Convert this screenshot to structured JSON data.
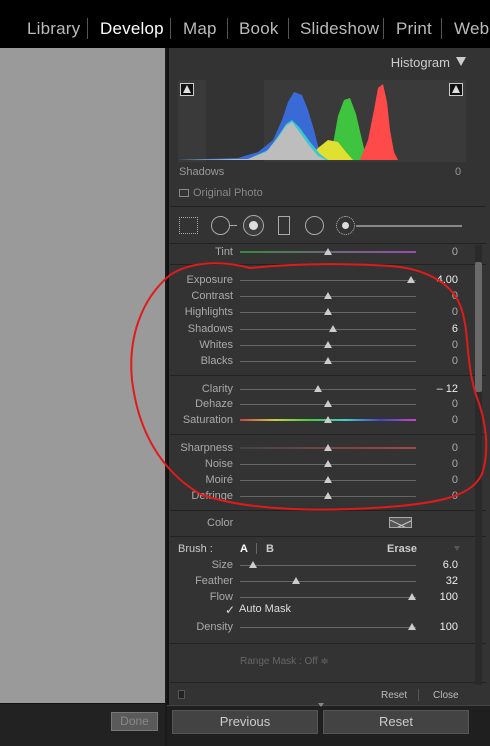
{
  "modules": [
    "Library",
    "Develop",
    "Map",
    "Book",
    "Slideshow",
    "Print",
    "Web"
  ],
  "active_module": "Develop",
  "left": {
    "done_label": "Done"
  },
  "histogram": {
    "title": "Histogram",
    "info_label": "Shadows",
    "info_value": "0",
    "original_photo_label": "Original Photo"
  },
  "tools": {
    "grid": "crop-overlay-icon",
    "spot": "spot-removal-icon",
    "redeye": "red-eye-icon",
    "grad": "graduated-filter-icon",
    "radial": "radial-filter-icon",
    "brush": "adjustment-brush-icon"
  },
  "sliders": {
    "tint": {
      "label": "Tint",
      "value": "0"
    },
    "exposure": {
      "label": "Exposure",
      "value": "4.00"
    },
    "contrast": {
      "label": "Contrast",
      "value": "0"
    },
    "highlights": {
      "label": "Highlights",
      "value": "0"
    },
    "shadows": {
      "label": "Shadows",
      "value": "6"
    },
    "whites": {
      "label": "Whites",
      "value": "0"
    },
    "blacks": {
      "label": "Blacks",
      "value": "0"
    },
    "clarity": {
      "label": "Clarity",
      "value": "– 12"
    },
    "dehaze": {
      "label": "Dehaze",
      "value": "0"
    },
    "saturation": {
      "label": "Saturation",
      "value": "0"
    },
    "sharpness": {
      "label": "Sharpness",
      "value": "0"
    },
    "noise": {
      "label": "Noise",
      "value": "0"
    },
    "moire": {
      "label": "Moiré",
      "value": "0"
    },
    "defringe": {
      "label": "Defringe",
      "value": "0"
    }
  },
  "color": {
    "label": "Color"
  },
  "brush": {
    "label": "Brush :",
    "a": "A",
    "b": "B",
    "erase": "Erase",
    "size": {
      "label": "Size",
      "value": "6.0"
    },
    "feather": {
      "label": "Feather",
      "value": "32"
    },
    "flow": {
      "label": "Flow",
      "value": "100"
    },
    "automask_check": "✓",
    "automask_label": "Auto Mask",
    "density": {
      "label": "Density",
      "value": "100"
    }
  },
  "range_mask": "Range Mask : Off ≑",
  "footer": {
    "reset_small": "Reset",
    "close_small": "Close"
  },
  "buttons": {
    "previous": "Previous",
    "reset": "Reset"
  }
}
